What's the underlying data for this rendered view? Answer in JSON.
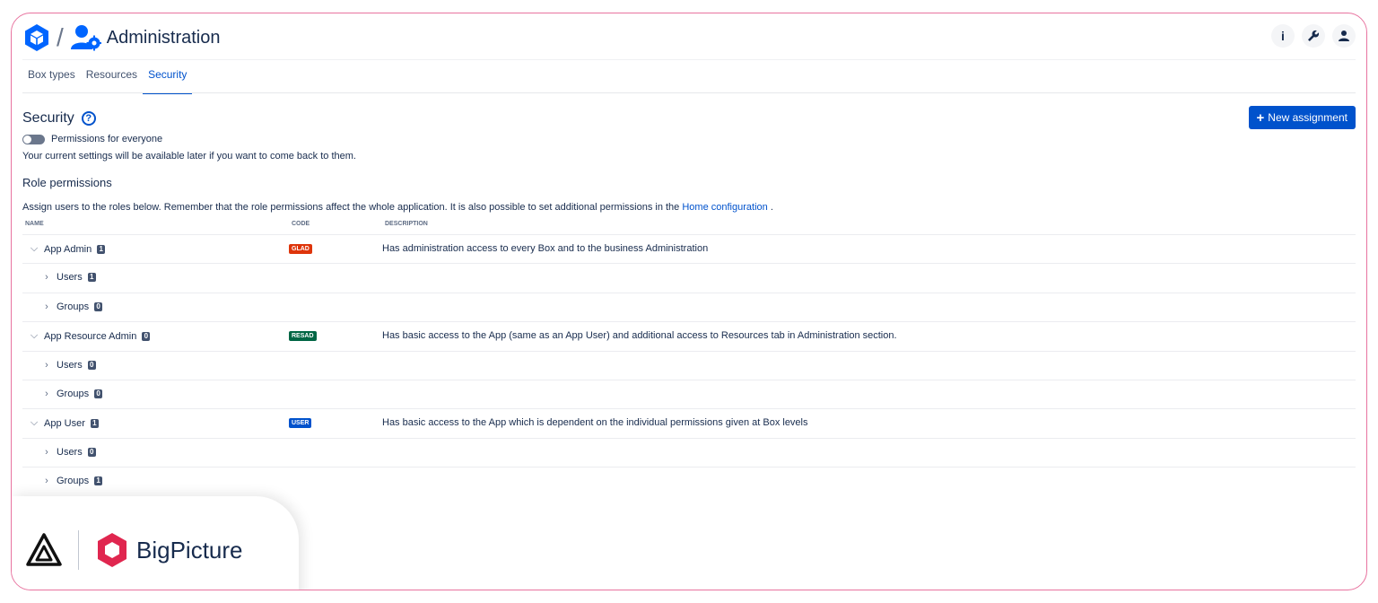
{
  "header": {
    "title": "Administration",
    "separator": "/",
    "right_buttons": [
      {
        "name": "info-icon",
        "glyph": "i"
      },
      {
        "name": "wrench-icon",
        "glyph": "🔧"
      },
      {
        "name": "user-icon",
        "glyph": "👤"
      }
    ]
  },
  "tabs": [
    {
      "label": "Box types",
      "active": false
    },
    {
      "label": "Resources",
      "active": false
    },
    {
      "label": "Security",
      "active": true
    }
  ],
  "security": {
    "title": "Security",
    "help_glyph": "?",
    "new_button_plus": "+",
    "new_button_label": "New assignment",
    "toggle_label": "Permissions for everyone",
    "toggle_on": false,
    "note": "Your current settings will be available later if you want to come back to them."
  },
  "role_permissions": {
    "title": "Role permissions",
    "assign_text": "Assign users to the roles below. Remember that the role permissions affect the whole application. It is also possible to set additional permissions in the",
    "assign_link": "Home configuration",
    "assign_end": "."
  },
  "table": {
    "columns": {
      "name": "NAME",
      "code": "CODE",
      "description": "DESCRIPTION"
    },
    "rows": [
      {
        "name": "App Admin",
        "count": "1",
        "level": 0,
        "code": "GLAD",
        "code_color": "#de350b",
        "description": "Has administration access to every Box and to the business Administration"
      },
      {
        "name": "Users",
        "count": "1",
        "level": 1
      },
      {
        "name": "Groups",
        "count": "0",
        "level": 1
      },
      {
        "name": "App Resource Admin",
        "count": "0",
        "level": 0,
        "code": "RESAD",
        "code_color": "#006644",
        "description": "Has basic access to the App (same as an App User) and additional access to Resources tab in Administration section."
      },
      {
        "name": "Users",
        "count": "0",
        "level": 1
      },
      {
        "name": "Groups",
        "count": "0",
        "level": 1
      },
      {
        "name": "App User",
        "count": "1",
        "level": 0,
        "code": "USER",
        "code_color": "#0052cc",
        "description": "Has basic access to the App which is dependent on the individual permissions given at Box levels"
      },
      {
        "name": "Users",
        "count": "0",
        "level": 1
      },
      {
        "name": "Groups",
        "count": "1",
        "level": 1
      }
    ]
  },
  "brand": {
    "name": "BigPicture",
    "accent": "#e0264f"
  },
  "colors": {
    "primary": "#0052cc",
    "frame_border": "#e8739f",
    "text": "#172b4d"
  }
}
